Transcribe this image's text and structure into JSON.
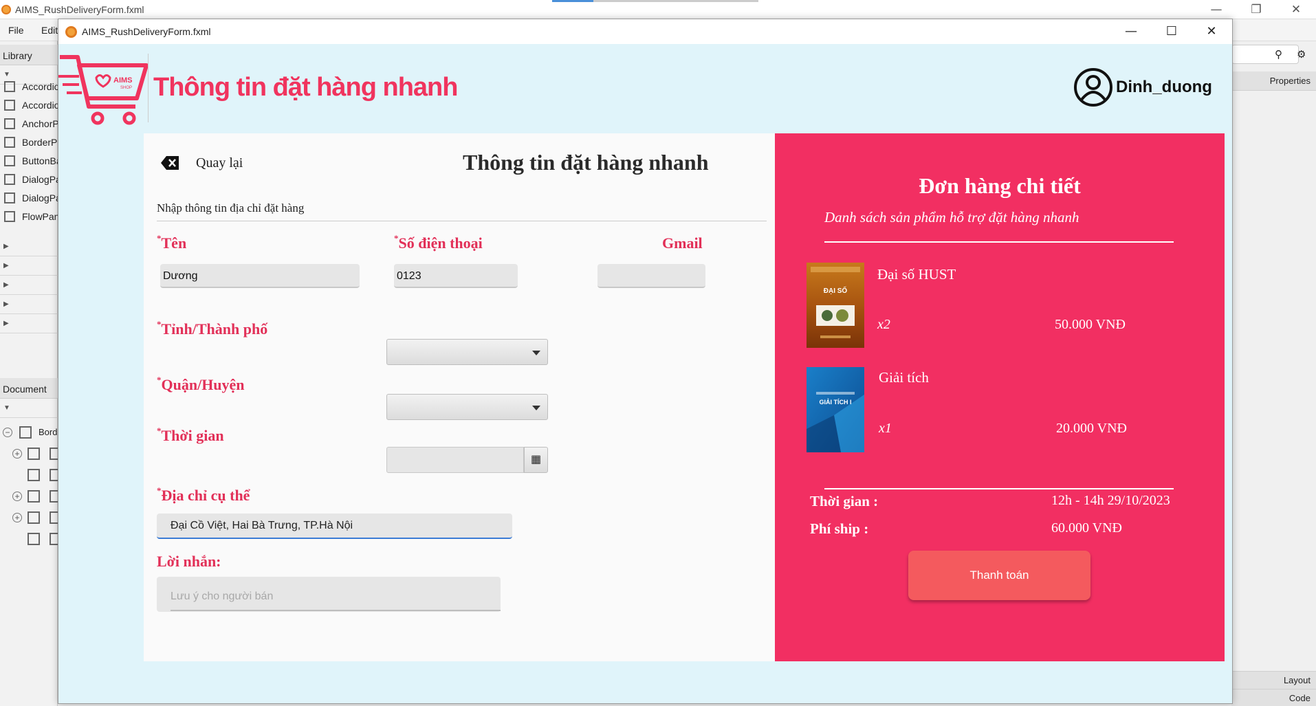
{
  "background_app": {
    "title": "AIMS_RushDeliveryForm.fxml",
    "menu": [
      "File",
      "Edit"
    ],
    "library_label": "Library",
    "library_items": [
      "Accordion",
      "Accordion",
      "AnchorPane",
      "BorderPane",
      "ButtonBar",
      "DialogPane",
      "DialogPane",
      "FlowPane"
    ],
    "document_label": "Document",
    "tree_root": "BorderPane",
    "properties_label": "Properties",
    "layout_label": "Layout",
    "code_label": "Code"
  },
  "window": {
    "title": "AIMS_RushDeliveryForm.fxml"
  },
  "header": {
    "title": "Thông tin đặt hàng nhanh",
    "username": "Dinh_duong",
    "logo_text": "AIMS",
    "logo_subtext": "SHOP"
  },
  "form": {
    "back_label": "Quay lại",
    "title": "Thông tin đặt hàng nhanh",
    "subtitle": "Nhập thông tin địa chỉ đặt hàng",
    "name_label": "Tên",
    "name_value": "Dương",
    "phone_label": "Số điện thoại",
    "phone_value": "0123",
    "gmail_label": "Gmail",
    "gmail_value": "",
    "province_label": "Tỉnh/Thành phố",
    "district_label": "Quận/Huyện",
    "time_label": "Thời gian",
    "address_label": "Địa chỉ cụ thể",
    "address_value": "Đại Cồ Việt, Hai Bà Trưng, TP.Hà Nội",
    "note_label": "Lời nhắn:",
    "note_placeholder": "Lưu ý cho người bán",
    "required_mark": "*"
  },
  "order": {
    "title": "Đơn hàng chi tiết",
    "subtitle": "Danh sách sản phẩm hỗ trợ đặt hàng nhanh",
    "products": [
      {
        "name": "Đại số HUST",
        "qty": "x2",
        "price": "50.000 VNĐ",
        "cover_text": "ĐẠI SỐ"
      },
      {
        "name": "Giải tích",
        "qty": "x1",
        "price": "20.000 VNĐ",
        "cover_text": "GIẢI TÍCH I"
      }
    ],
    "time_label": "Thời gian :",
    "time_value": "12h - 14h 29/10/2023",
    "ship_label": "Phí ship :",
    "ship_value": "60.000 VNĐ",
    "pay_button": "Thanh toán"
  },
  "colors": {
    "accent": "#f0345e",
    "order_panel": "#f22f62",
    "pay_button": "#f45a5e",
    "window_bg": "#e0f4fa"
  }
}
